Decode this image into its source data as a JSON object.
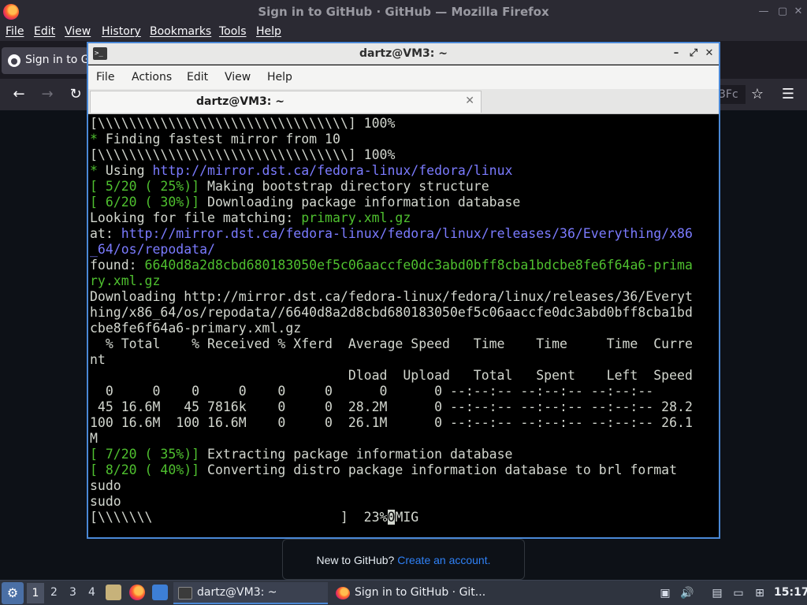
{
  "firefox": {
    "window_title": "Sign in to GitHub · GitHub — Mozilla Firefox",
    "menus": [
      "File",
      "Edit",
      "View",
      "History",
      "Bookmarks",
      "Tools",
      "Help"
    ],
    "tab_label": "Sign in to GitHub",
    "url_fragment": "3Fc",
    "github_prompt": "New to GitHub?",
    "github_link": "Create an account."
  },
  "terminal": {
    "title": "dartz@VM3: ~",
    "menus": [
      "File",
      "Actions",
      "Edit",
      "View",
      "Help"
    ],
    "tab_label": "dartz@VM3: ~",
    "lines": [
      [
        {
          "t": "[\\\\\\\\\\\\\\\\\\\\\\\\\\\\\\\\\\\\\\\\\\\\\\\\\\\\\\\\\\\\\\\\] 100%"
        }
      ],
      [
        {
          "t": "* ",
          "c": "g"
        },
        {
          "t": "Finding fastest mirror from 10"
        }
      ],
      [
        {
          "t": "[\\\\\\\\\\\\\\\\\\\\\\\\\\\\\\\\\\\\\\\\\\\\\\\\\\\\\\\\\\\\\\\\] 100%"
        }
      ],
      [
        {
          "t": "* ",
          "c": "g"
        },
        {
          "t": "Using "
        },
        {
          "t": "http://mirror.dst.ca/fedora-linux/fedora/linux",
          "c": "b"
        }
      ],
      [
        {
          "t": "[ 5/20 ( 25%)] ",
          "c": "g"
        },
        {
          "t": "Making bootstrap directory structure"
        }
      ],
      [
        {
          "t": "[ 6/20 ( 30%)] ",
          "c": "g"
        },
        {
          "t": "Downloading package information database"
        }
      ],
      [
        {
          "t": "Looking for file matching: "
        },
        {
          "t": "primary.xml.gz",
          "c": "g"
        }
      ],
      [
        {
          "t": "at: "
        },
        {
          "t": "http://mirror.dst.ca/fedora-linux/fedora/linux/releases/36/Everything/x86",
          "c": "b"
        }
      ],
      [
        {
          "t": "_64/os/repodata/",
          "c": "b"
        }
      ],
      [
        {
          "t": "found: "
        },
        {
          "t": "6640d8a2d8cbd680183050ef5c06aaccfe0dc3abd0bff8cba1bdcbe8fe6f64a6-prima",
          "c": "g"
        }
      ],
      [
        {
          "t": "ry.xml.gz",
          "c": "g"
        }
      ],
      [
        {
          "t": "Downloading http://mirror.dst.ca/fedora-linux/fedora/linux/releases/36/Everyt"
        }
      ],
      [
        {
          "t": "hing/x86_64/os/repodata//6640d8a2d8cbd680183050ef5c06aaccfe0dc3abd0bff8cba1bd"
        }
      ],
      [
        {
          "t": "cbe8fe6f64a6-primary.xml.gz"
        }
      ],
      [
        {
          "t": "  % Total    % Received % Xferd  Average Speed   Time    Time     Time  Curre"
        }
      ],
      [
        {
          "t": "nt"
        }
      ],
      [
        {
          "t": "                                 Dload  Upload   Total   Spent    Left  Speed"
        }
      ],
      [
        {
          "t": "  0     0    0     0    0     0      0      0 --:--:-- --:--:-- --:--:--"
        }
      ],
      [
        {
          "t": " 45 16.6M   45 7816k    0     0  28.2M      0 --:--:-- --:--:-- --:--:-- 28.2"
        }
      ],
      [
        {
          "t": "100 16.6M  100 16.6M    0     0  26.1M      0 --:--:-- --:--:-- --:--:-- 26.1"
        }
      ],
      [
        {
          "t": "M"
        }
      ],
      [
        {
          "t": "[ 7/20 ( 35%)] ",
          "c": "g"
        },
        {
          "t": "Extracting package information database"
        }
      ],
      [
        {
          "t": "[ 8/20 ( 40%)] ",
          "c": "g"
        },
        {
          "t": "Converting distro package information database to brl format"
        }
      ],
      [
        {
          "t": "sudo"
        }
      ],
      [
        {
          "t": "sudo"
        }
      ],
      [
        {
          "t": "[\\\\\\\\\\\\\\                        ]  23%"
        },
        {
          "t": "0",
          "c": "cur"
        },
        {
          "t": "MIG"
        }
      ]
    ]
  },
  "taskbar": {
    "workspaces": [
      "1",
      "2",
      "3",
      "4"
    ],
    "tasks": [
      "dartz@VM3: ~",
      "Sign in to GitHub · Git..."
    ],
    "clock": "15:17"
  }
}
